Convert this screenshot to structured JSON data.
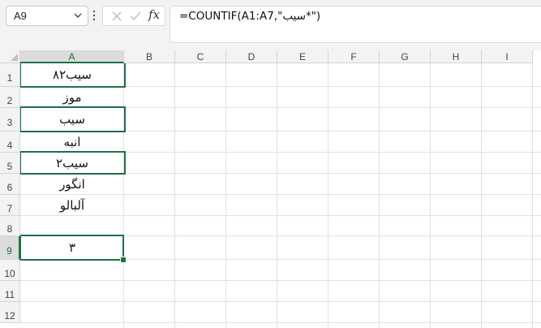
{
  "name_box": {
    "value": "A9"
  },
  "formula_bar": {
    "fx_label": "fx",
    "formula": "=COUNTIF(A1:A7,\"سیب*\")"
  },
  "columns": [
    "A",
    "B",
    "C",
    "D",
    "E",
    "F",
    "G",
    "H",
    "I"
  ],
  "rows": [
    "1",
    "2",
    "3",
    "4",
    "5",
    "6",
    "7",
    "8",
    "9",
    "10",
    "11",
    "12"
  ],
  "cells": {
    "A1": "سیب۸۲",
    "A2": "موز",
    "A3": "سیب",
    "A4": "انبه",
    "A5": "سیب۲",
    "A6": "انگور",
    "A7": "آلبالو",
    "A9": "۳"
  },
  "active_cell": "A9",
  "highlighted_cells": [
    "A1",
    "A3",
    "A5"
  ],
  "colors": {
    "accent_green": "#1e7145",
    "header_bg": "#f3f3f3",
    "gridline": "#e1e1e1"
  }
}
